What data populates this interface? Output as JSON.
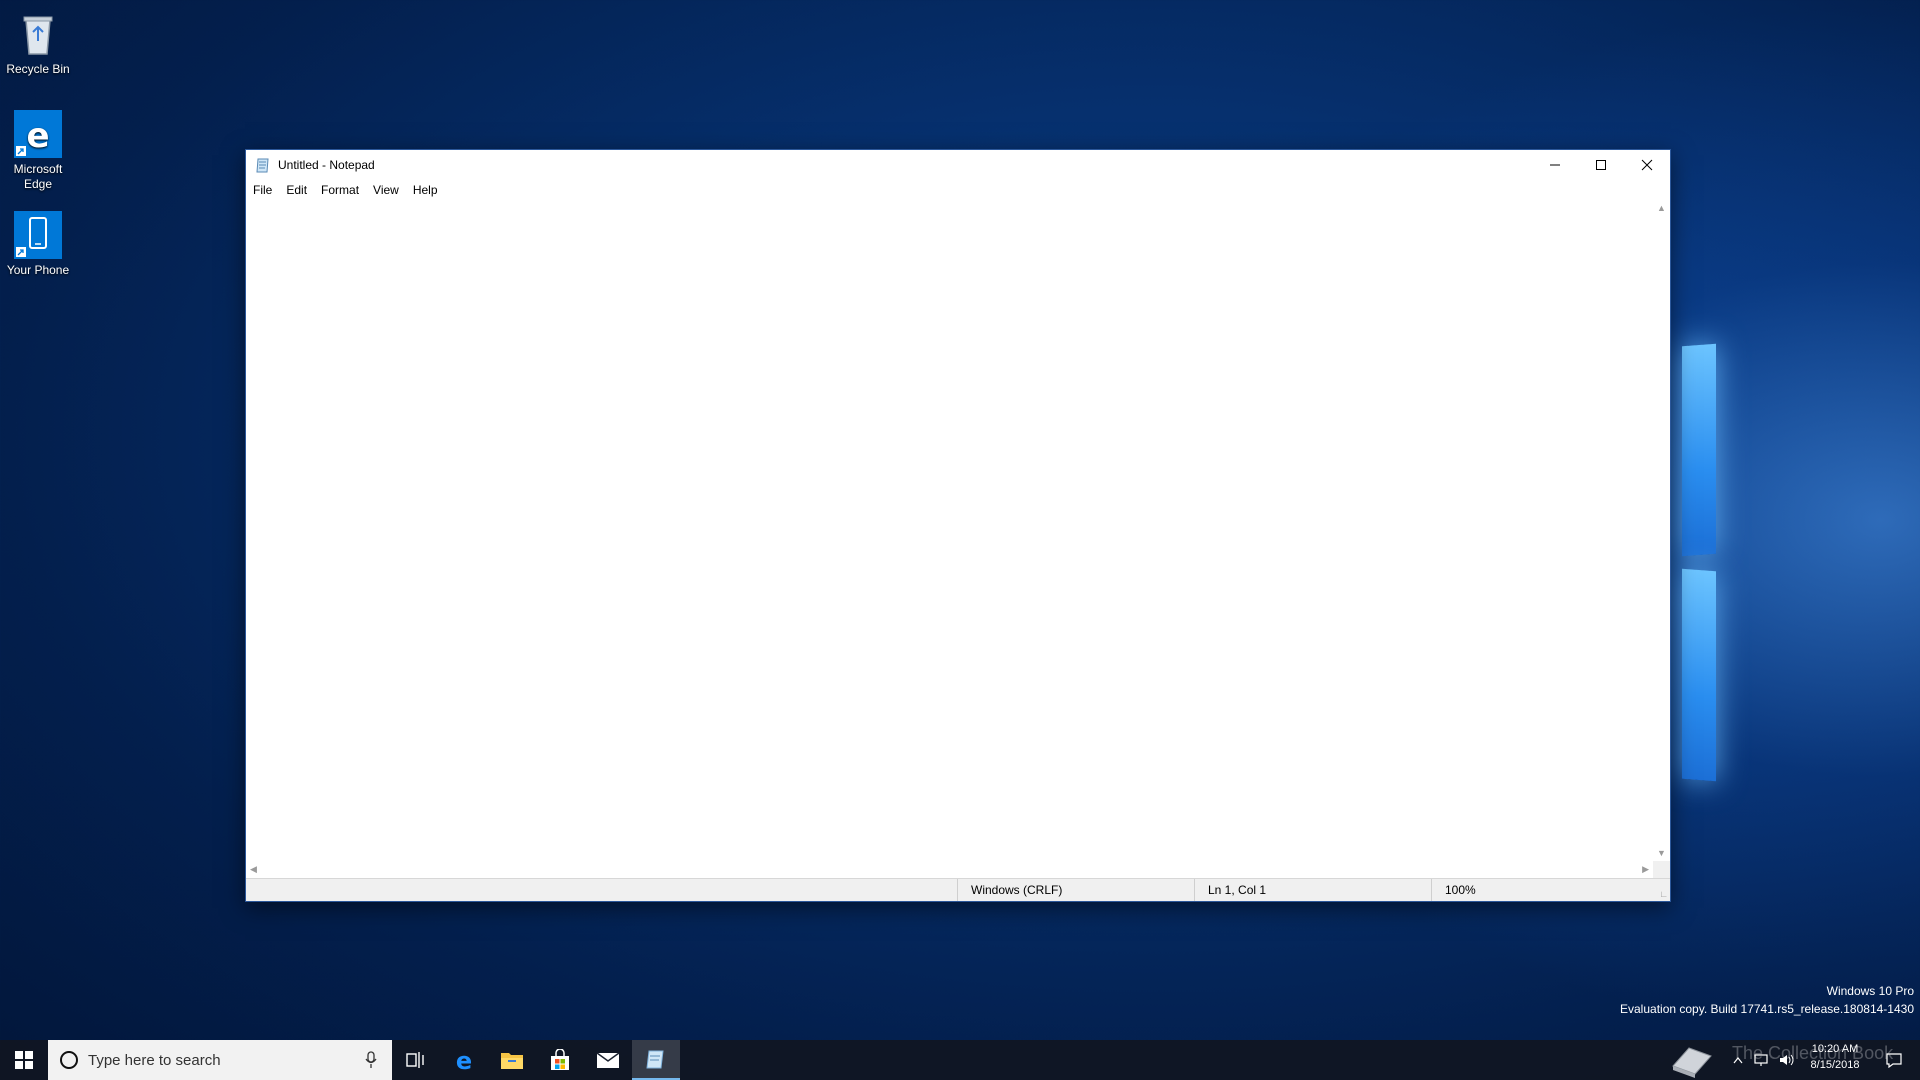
{
  "desktop": {
    "icons": [
      {
        "label": "Recycle Bin",
        "icon": "recycle-bin-icon"
      },
      {
        "label": "Microsoft Edge",
        "icon": "edge-icon"
      },
      {
        "label": "Your Phone",
        "icon": "phone-icon"
      }
    ]
  },
  "notepad": {
    "title": "Untitled - Notepad",
    "menu": [
      "File",
      "Edit",
      "Format",
      "View",
      "Help"
    ],
    "content": "",
    "status": {
      "line_ending": "Windows (CRLF)",
      "position": "Ln 1, Col 1",
      "zoom": "100%"
    }
  },
  "taskbar": {
    "search_placeholder": "Type here to search",
    "apps": [
      "task-view-icon",
      "edge-icon",
      "file-explorer-icon",
      "store-icon",
      "mail-icon",
      "notepad-icon"
    ],
    "clock_time": "10:20 AM",
    "clock_date": "8/15/2018"
  },
  "watermark": {
    "edition": "Windows 10 Pro",
    "build": "Evaluation copy. Build 17741.rs5_release.180814-1430"
  },
  "overlay_text": "The Collection Book",
  "colors": {
    "accent": "#0078d7",
    "desktop_bg": "#06306e",
    "taskbar_bg": "#101622"
  }
}
